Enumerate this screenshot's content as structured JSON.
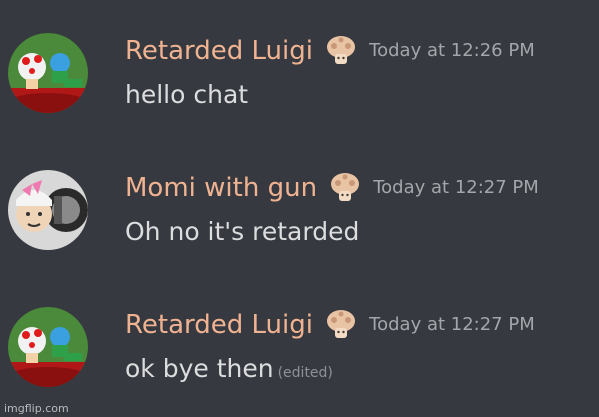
{
  "messages": [
    {
      "username": "Retarded Luigi",
      "timestamp": "Today at 12:26 PM",
      "text": "hello chat",
      "edited": "",
      "avatar_icon": "toad-luigi-avatar",
      "badge_icon": "mushroom-badge-icon"
    },
    {
      "username": "Momi with gun",
      "timestamp": "Today at 12:27 PM",
      "text": "Oh no it's retarded",
      "edited": "",
      "avatar_icon": "momi-gun-avatar",
      "badge_icon": "mushroom-badge-icon"
    },
    {
      "username": "Retarded Luigi",
      "timestamp": "Today at 12:27 PM",
      "text": "ok bye then",
      "edited": "(edited)",
      "avatar_icon": "toad-luigi-avatar",
      "badge_icon": "mushroom-badge-icon"
    }
  ],
  "watermark": "imgflip.com",
  "colors": {
    "background": "#36393f",
    "username": "#f0b392",
    "timestamp": "#a3a6aa",
    "message_text": "#dcddde"
  }
}
